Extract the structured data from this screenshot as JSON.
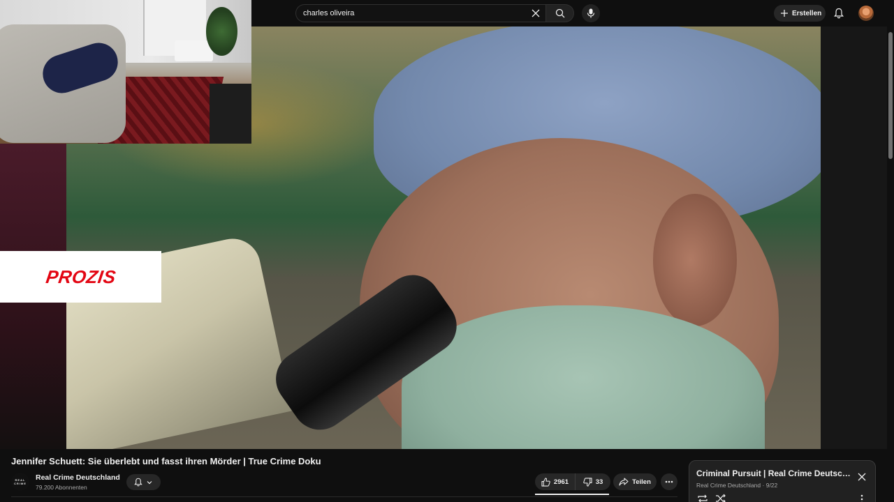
{
  "search": {
    "query": "charles oliveira",
    "clear_icon": "close-icon",
    "search_icon": "search-icon",
    "mic_icon": "microphone-icon"
  },
  "header": {
    "create_label": "Erstellen",
    "create_icon": "plus-icon",
    "notifications_icon": "bell-icon",
    "avatar_icon": "user-avatar"
  },
  "ad": {
    "brand": "PROZIS",
    "brand_color": "#e30613"
  },
  "video": {
    "title": "Jennifer Schuett: Sie überlebt und fasst ihren Mörder | True Crime Doku",
    "channel": {
      "name": "Real Crime Deutschland",
      "subscribers": "79.200 Abonnenten",
      "logo_lines": [
        "REAL",
        "CRIME"
      ]
    },
    "actions": {
      "likes": "2961",
      "dislikes": "33",
      "share_label": "Teilen"
    }
  },
  "playlist": {
    "title": "Criminal Pursuit | Real Crime Deutschland",
    "channel": "Real Crime Deutschland",
    "separator": "·",
    "position": "9/22"
  },
  "colors": {
    "background": "#0f0f0f",
    "button": "#272727",
    "text_secondary": "#aaaaaa"
  }
}
